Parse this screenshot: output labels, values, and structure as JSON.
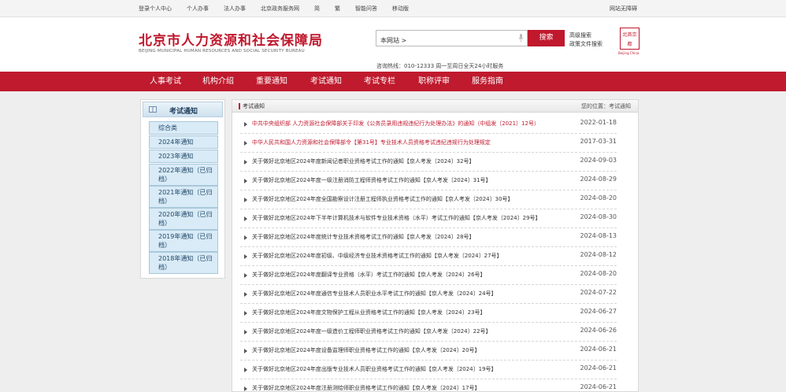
{
  "topbar": {
    "links": [
      "登录个人中心",
      "个人办事",
      "法人办事",
      "北京政务服务网",
      "简",
      "繁",
      "智能问答",
      "移动版"
    ],
    "right": "网站无障碍"
  },
  "header": {
    "title_cn": "北京市人力资源和社会保障局",
    "title_en": "BEIJING MUNICIPAL HUMAN RESOURCES AND SOCIAL SECURITY BUREAU",
    "search_value": "本网站 >",
    "search_button": "搜索",
    "advanced_search": "高级搜索",
    "policy_search": "政策文件搜索",
    "hotline": "咨询热线：010-12333 周一至周日全天24小时服务",
    "seal_chars": [
      "北",
      "首",
      "京",
      "都"
    ],
    "seal_en": "Beijing China"
  },
  "nav": [
    "人事考试",
    "机构介绍",
    "重要通知",
    "考试通知",
    "考试专栏",
    "职称评审",
    "服务指南"
  ],
  "sidebar": {
    "title": "考试通知",
    "items": [
      "综合类",
      "2024年通知",
      "2023年通知",
      "2022年通知（已归档）",
      "2021年通知（已归档）",
      "2020年通知（已归档）",
      "2019年通知（已归档）",
      "2018年通知（已归档）"
    ]
  },
  "content": {
    "heading": "考试通知",
    "location": "您的位置：考试通知",
    "rows": [
      {
        "title": "中共中央组织部 人力资源社会保障部关于印发《公务员录用违规违纪行为处理办法》的通知（中组发〔2021〕12号）",
        "date": "2022-01-18",
        "highlight": true
      },
      {
        "title": "中华人民共和国人力资源和社会保障部令【第31号】专业技术人员资格考试违纪违规行为处理规定",
        "date": "2017-03-31",
        "highlight": true
      },
      {
        "title": "关于做好北京地区2024年度新闻记者职业资格考试工作的通知【京人考发〔2024〕32号】",
        "date": "2024-09-03",
        "highlight": false
      },
      {
        "title": "关于做好北京地区2024年度一级注册消防工程师资格考试工作的通知【京人考发〔2024〕31号】",
        "date": "2024-08-29",
        "highlight": false
      },
      {
        "title": "关于做好北京地区2024年度全国勘察设计注册工程师执业资格考试工作的通知【京人考发〔2024〕30号】",
        "date": "2024-08-20",
        "highlight": false
      },
      {
        "title": "关于做好北京地区2024年下半年计算机技术与软件专业技术资格（水平）考试工作的通知【京人考发〔2024〕29号】",
        "date": "2024-08-30",
        "highlight": false
      },
      {
        "title": "关于做好北京地区2024年度统计专业技术资格考试工作的通知【京人考发〔2024〕28号】",
        "date": "2024-08-13",
        "highlight": false
      },
      {
        "title": "关于做好北京地区2024年度初级、中级经济专业技术资格考试工作的通知【京人考发〔2024〕27号】",
        "date": "2024-08-12",
        "highlight": false
      },
      {
        "title": "关于做好北京地区2024年度翻译专业资格（水平）考试工作的通知【京人考发〔2024〕26号】",
        "date": "2024-08-20",
        "highlight": false
      },
      {
        "title": "关于做好北京地区2024年度通信专业技术人员职业水平考试工作的通知【京人考发〔2024〕24号】",
        "date": "2024-07-22",
        "highlight": false
      },
      {
        "title": "关于做好北京地区2024年度文物保护工程从业资格考试工作的通知【京人考发〔2024〕23号】",
        "date": "2024-06-27",
        "highlight": false
      },
      {
        "title": "关于做好北京地区2024年度一级造价工程师职业资格考试工作的通知【京人考发〔2024〕22号】",
        "date": "2024-06-26",
        "highlight": false
      },
      {
        "title": "关于做好北京地区2024年度设备监理师职业资格考试工作的通知【京人考发〔2024〕20号】",
        "date": "2024-06-21",
        "highlight": false
      },
      {
        "title": "关于做好北京地区2024年度出版专业技术人员职业资格考试工作的通知【京人考发〔2024〕19号】",
        "date": "2024-06-21",
        "highlight": false
      },
      {
        "title": "关于做好北京地区2024年度注册测绘师职业资格考试工作的通知【京人考发〔2024〕17号】",
        "date": "2024-06-21",
        "highlight": false
      }
    ]
  },
  "colors": {
    "brand_red": "#c0182d",
    "sidebar_blue": "#d8ebf6"
  },
  "icons": [
    "microphone-icon",
    "book-icon",
    "triangle-bullet-icon"
  ]
}
